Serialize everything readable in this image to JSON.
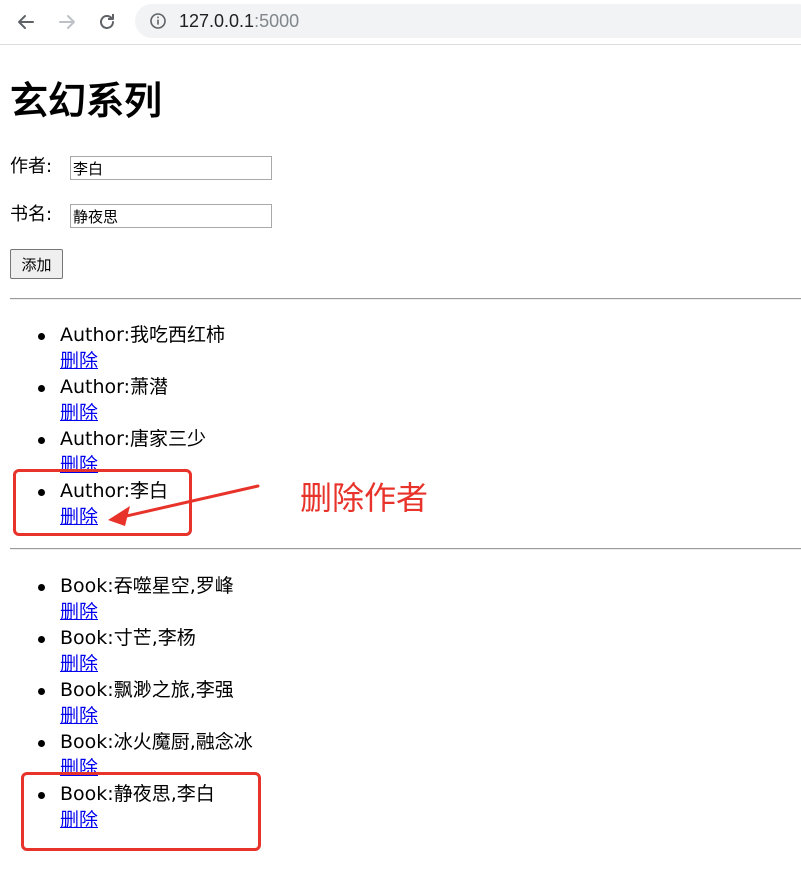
{
  "browser": {
    "url_host": "127.0.0.1",
    "url_port": ":5000"
  },
  "page": {
    "title": "玄幻系列",
    "author_label": "作者:",
    "author_value": "李白",
    "book_label": "书名:",
    "book_value": "静夜思",
    "add_button": "添加"
  },
  "authors": [
    {
      "text": "Author:我吃西红柿",
      "delete": "删除"
    },
    {
      "text": "Author:萧潜",
      "delete": "删除"
    },
    {
      "text": "Author:唐家三少",
      "delete": "删除"
    },
    {
      "text": "Author:李白",
      "delete": "删除"
    }
  ],
  "books": [
    {
      "text": "Book:吞噬星空,罗峰",
      "delete": "删除"
    },
    {
      "text": "Book:寸芒,李杨",
      "delete": "删除"
    },
    {
      "text": "Book:飘渺之旅,李强",
      "delete": "删除"
    },
    {
      "text": "Book:冰火魔厨,融念冰",
      "delete": "删除"
    },
    {
      "text": "Book:静夜思,李白",
      "delete": "删除"
    }
  ],
  "annotation": {
    "text": "删除作者",
    "color": "#e8332a"
  },
  "icons": {
    "back": "back-arrow-icon",
    "forward": "forward-arrow-icon",
    "reload": "reload-icon",
    "site_info": "info-icon"
  }
}
